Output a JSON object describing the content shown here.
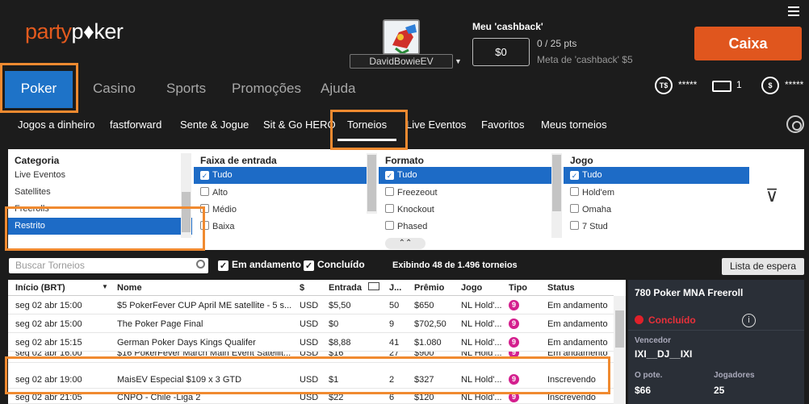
{
  "brand": {
    "party": "party",
    "poker": "p♦ker"
  },
  "user": {
    "name": "DavidBowieEV"
  },
  "cashback": {
    "title": "Meu 'cashback'",
    "value": "$0",
    "pts": "0 / 25 pts",
    "meta": "Meta de 'cashback' $5"
  },
  "caixa": "Caixa",
  "main_nav": [
    "Poker",
    "Casino",
    "Sports",
    "Promoções",
    "Ajuda"
  ],
  "stats": {
    "ts_icon": "T$",
    "ts_value": "*****",
    "tickets": "1",
    "dollar_icon": "$",
    "balance": "*****"
  },
  "sub_nav": [
    "Jogos a dinheiro",
    "fastforward",
    "Sente & Jogue",
    "Sit & Go HERO",
    "Torneios",
    "Live Eventos",
    "Favoritos",
    "Meus torneios"
  ],
  "filters": {
    "categoria": {
      "header": "Categoria",
      "items": [
        "Live Eventos",
        "Satellites",
        "Freerolls",
        "Restrito"
      ],
      "selected": "Restrito"
    },
    "faixa": {
      "header": "Faixa de entrada",
      "items": [
        "Tudo",
        "Alto",
        "Médio",
        "Baixa"
      ],
      "selected": "Tudo"
    },
    "formato": {
      "header": "Formato",
      "items": [
        "Tudo",
        "Freezeout",
        "Knockout",
        "Phased"
      ],
      "selected": "Tudo"
    },
    "jogo": {
      "header": "Jogo",
      "items": [
        "Tudo",
        "Hold'em",
        "Omaha",
        "7 Stud"
      ],
      "selected": "Tudo"
    },
    "expand_icon": "⌃⌃",
    "funnel_icon": "⊽"
  },
  "toolbar": {
    "search_placeholder": "Buscar Torneios",
    "em_andamento": "Em andamento",
    "concluido": "Concluído",
    "exibindo": "Exibindo 48 de 1.496 torneios",
    "lista": "Lista de espera"
  },
  "table": {
    "headers": [
      "Início (BRT)",
      "Nome",
      "$",
      "Entrada",
      "",
      "J...",
      "Prêmio",
      "Jogo",
      "Tipo",
      "Status"
    ],
    "rows": [
      [
        "seg 02 abr 15:00",
        "$5 PokerFever CUP April ME satellite - 5 s...",
        "USD",
        "$5,50",
        "50",
        "$650",
        "NL Hold'...",
        "9",
        "Em andamento"
      ],
      [
        "seg 02 abr 15:00",
        "The Poker Page Final",
        "USD",
        "$0",
        "9",
        "$702,50",
        "NL Hold'...",
        "9",
        "Em andamento"
      ],
      [
        "seg 02 abr 15:15",
        "German Poker Days Kings Qualifer",
        "USD",
        "$8,88",
        "41",
        "$1.080",
        "NL Hold'...",
        "9",
        "Em andamento"
      ],
      [
        "seg 02 abr 16:00",
        "$16 PokerFever March Main Event Satellit...",
        "USD",
        "$16",
        "27",
        "$900",
        "NL Hold'...",
        "9",
        "Em andamento"
      ],
      [
        "seg 02 abr 19:00",
        "MaisEV Especial $109 x 3 GTD",
        "USD",
        "$1",
        "2",
        "$327",
        "NL Hold'...",
        "9",
        "Inscrevendo"
      ],
      [
        "seg 02 abr 21:05",
        "CNPO - Chile -Liga 2",
        "USD",
        "$22",
        "6",
        "$120",
        "NL Hold'...",
        "9",
        "Inscrevendo"
      ]
    ]
  },
  "panel": {
    "title": "780 Poker MNA Freeroll",
    "status": "Concluído",
    "info_icon": "i",
    "vencedor_lbl": "Vencedor",
    "vencedor": "IXI__DJ__IXI",
    "pote_lbl": "O pote.",
    "pote": "$66",
    "jogadores_lbl": "Jogadores",
    "jogadores": "25"
  },
  "colors": {
    "accent": "#e0561e",
    "highlight": "#f08a30",
    "selected": "#1d6bc6"
  }
}
